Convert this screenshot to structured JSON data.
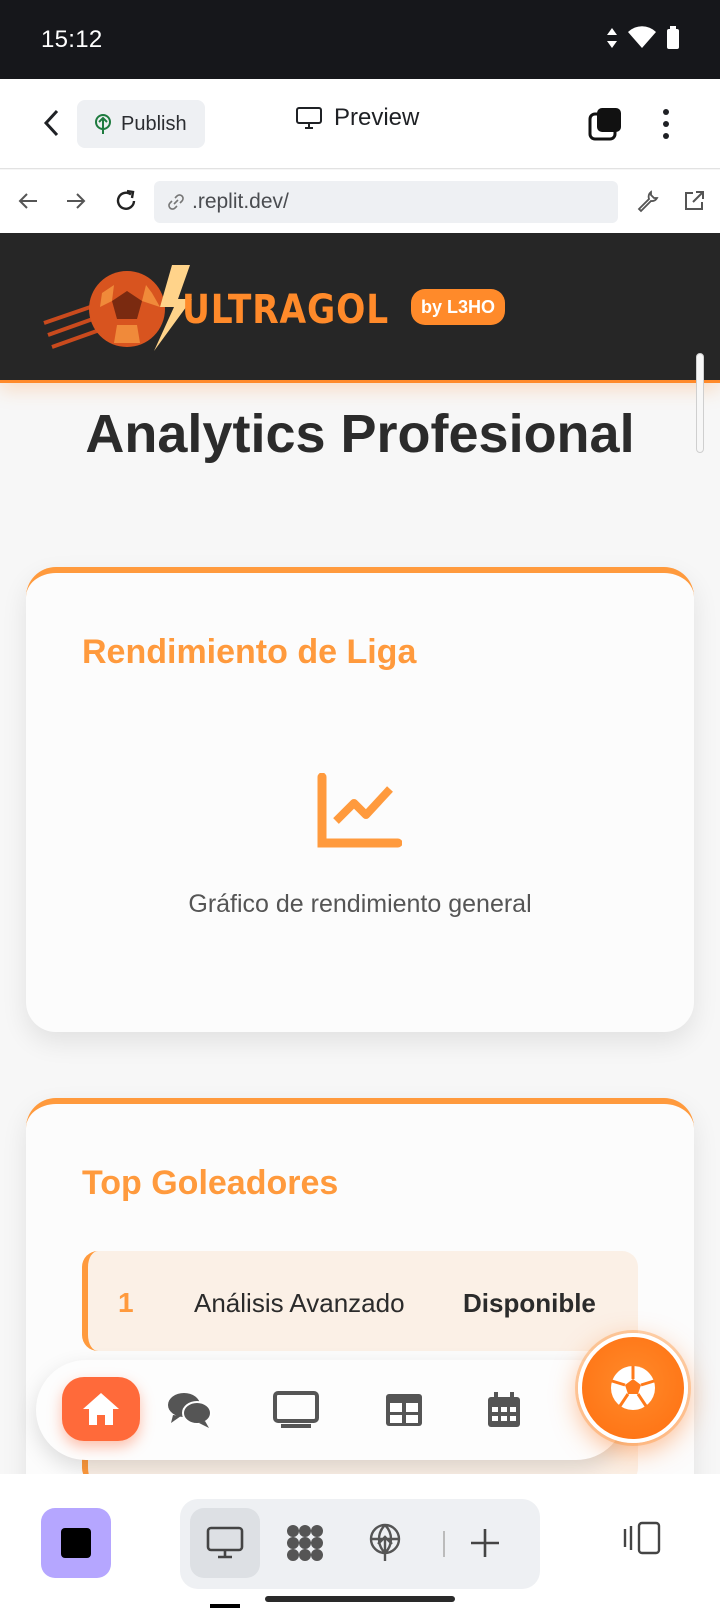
{
  "status_bar": {
    "time": "15:12"
  },
  "app_bar": {
    "publish_label": "Publish",
    "title": "Preview"
  },
  "url_bar": {
    "url": ".replit.dev/"
  },
  "site": {
    "brand": "ULTRAGOL",
    "badge": "by L3HO",
    "heading": "Analytics Profesional",
    "league_card": {
      "title": "Rendimiento de Liga",
      "caption": "Gráfico de rendimiento general"
    },
    "scorers_card": {
      "title": "Top Goleadores",
      "rows": [
        {
          "rank": "1",
          "name": "Análisis Avanzado",
          "status": "Disponible"
        }
      ]
    },
    "nav_items": [
      "home-icon",
      "chat-icon",
      "tv-icon",
      "table-icon",
      "calendar-icon"
    ],
    "fab_icon": "soccer-ball-icon"
  },
  "toolbar": {
    "tools": [
      "monitor-icon",
      "apps-grid-icon",
      "deploy-icon",
      "plus-icon"
    ]
  },
  "colors": {
    "accent": "#ff9a3d",
    "header_bg": "#262626",
    "stop_button": "#b5a6ff"
  }
}
